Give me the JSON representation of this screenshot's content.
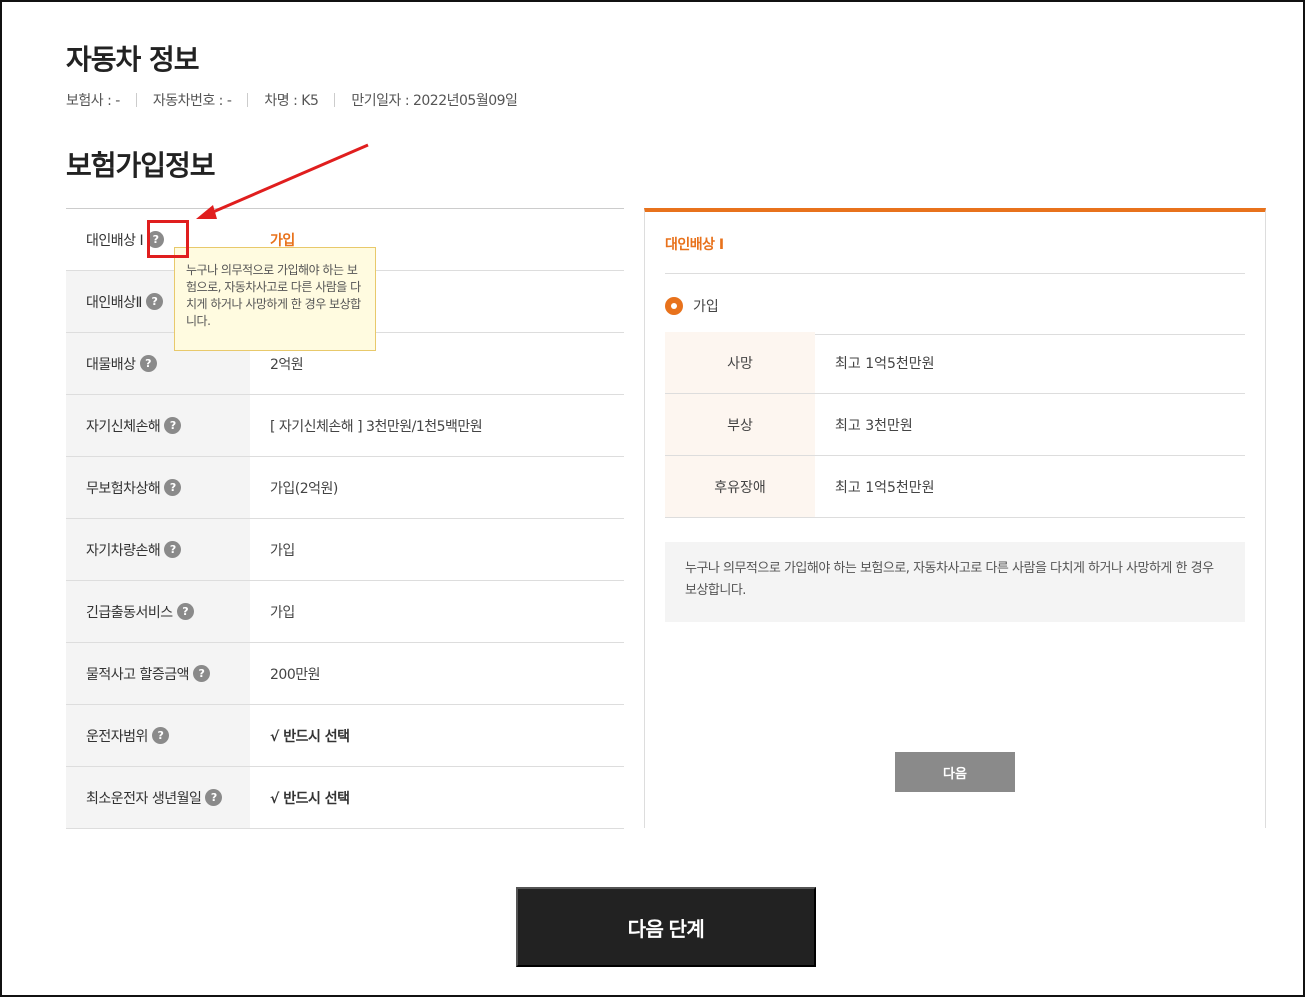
{
  "car_info": {
    "title": "자동차 정보",
    "insurer": "보험사 : -",
    "plate": "자동차번호 : -",
    "model": "차명 : K5",
    "expiry": "만기일자 : 2022년05월09일"
  },
  "insurance": {
    "title": "보험가입정보",
    "help_glyph": "?",
    "rows": [
      {
        "label": "대인배상 Ⅰ",
        "value": "가입"
      },
      {
        "label": "대인배상Ⅱ",
        "value": ""
      },
      {
        "label": "대물배상",
        "value": "2억원"
      },
      {
        "label": "자기신체손해",
        "value": "[ 자기신체손해 ]  3천만원/1천5백만원"
      },
      {
        "label": "무보험차상해",
        "value": "가입(2억원)"
      },
      {
        "label": "자기차량손해",
        "value": "가입"
      },
      {
        "label": "긴급출동서비스",
        "value": "가입"
      },
      {
        "label": "물적사고 할증금액",
        "value": "200만원"
      },
      {
        "label": "운전자범위",
        "value": "√ 반드시 선택"
      },
      {
        "label": "최소운전자 생년월일",
        "value": "√ 반드시 선택"
      }
    ],
    "tooltip": "누구나 의무적으로 가입해야 하는 보험으로, 자동차사고로 다른 사람을 다치게 하거나 사망하게 한 경우 보상합니다."
  },
  "detail_panel": {
    "title": "대인배상 Ⅰ",
    "option": "가입",
    "coverage": [
      {
        "name": "사망",
        "amount": "최고 1억5천만원"
      },
      {
        "name": "부상",
        "amount": "최고 3천만원"
      },
      {
        "name": "후유장애",
        "amount": "최고 1억5천만원"
      }
    ],
    "description": "누구나 의무적으로 가입해야 하는 보험으로, 자동차사고로 다른 사람을 다치게 하거나 사망하게 한 경우 보상합니다.",
    "next_label": "다음"
  },
  "footer": {
    "next_step_label": "다음 단계"
  },
  "colors": {
    "accent": "#e8721c",
    "annotation": "#e01e1e"
  }
}
